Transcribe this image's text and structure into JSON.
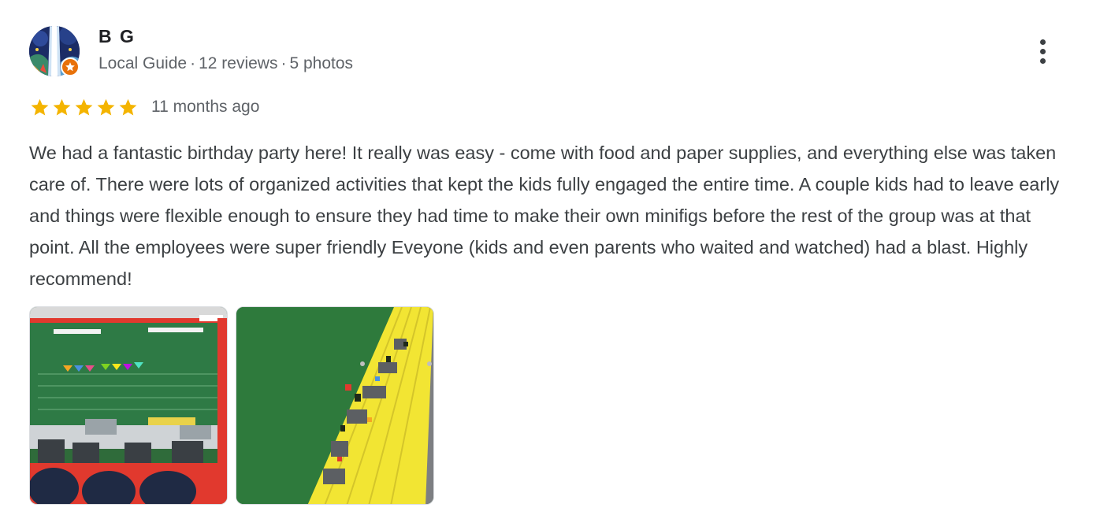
{
  "author": {
    "name": "B G",
    "role": "Local Guide",
    "reviews": "12 reviews",
    "photos": "5 photos",
    "separator": "·"
  },
  "rating": {
    "stars": 5,
    "max": 5,
    "star_color": "#f4b400",
    "time": "11 months ago"
  },
  "review": {
    "text": "We had a fantastic birthday party here! It really was easy - come with food and paper supplies, and everything else was taken care of. There were lots of organized activities that kept the kids fully engaged the entire time. A couple kids had to leave early and things were flexible enough to ensure they had time to make their own minifigs before the rest of the group was at that point. All the employees were super friendly Eveyone (kids and even parents who waited and watched) had a blast. Highly recommend!"
  },
  "icons": {
    "more": "more-vert-icon",
    "star": "star-icon",
    "badge": "local-guide-badge-icon"
  },
  "colors": {
    "text_primary": "#202124",
    "text_secondary": "#5f6368",
    "badge": "#e8710a"
  }
}
